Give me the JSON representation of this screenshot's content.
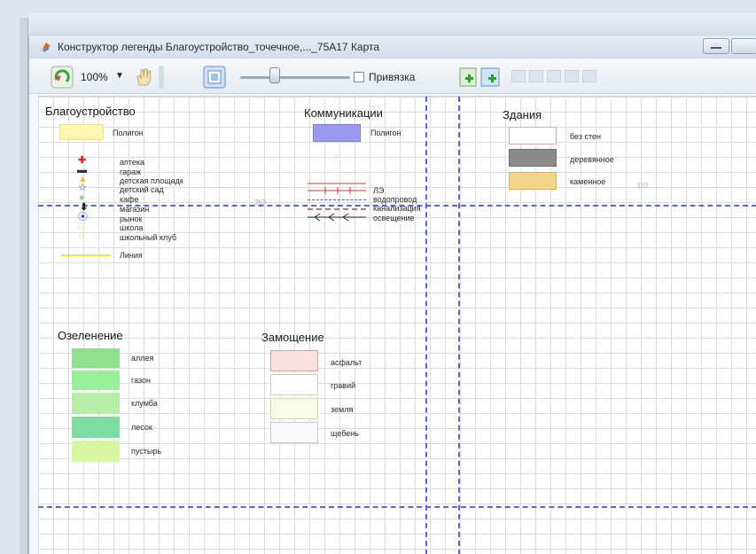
{
  "window": {
    "title": "Конструктор легенды Благоустройство_точечное,..._75А17 Карта"
  },
  "toolbar": {
    "zoom_value": "100%",
    "snap_label": "Привязка",
    "snap_checked": false,
    "zoom_slider_level": 0.27
  },
  "sections": {
    "blagoustroistvo": {
      "title": "Благоустройство",
      "polygon_label": "Полигон",
      "points": [
        {
          "label": "аптека",
          "icon": "cross-icon"
        },
        {
          "label": "гараж",
          "icon": "bar-icon"
        },
        {
          "label": "детская площадк",
          "icon": "triangle-icon"
        },
        {
          "label": "детский сад",
          "icon": "star-icon"
        },
        {
          "label": "кафе",
          "icon": "dot-icon"
        },
        {
          "label": "магазин",
          "icon": "arrow-down-icon"
        },
        {
          "label": "рынок",
          "icon": "target-icon"
        },
        {
          "label": "школа",
          "icon": "square-outline-icon"
        },
        {
          "label": "школьный клуб",
          "icon": "circle-outline-icon"
        }
      ],
      "line_label": "Линия"
    },
    "kommunikatsii": {
      "title": "Коммуникации",
      "polygon_label": "Полигон",
      "lines": [
        {
          "label": "ЛЭ",
          "color": "#e0303a"
        },
        {
          "label": "водопровод",
          "color": "#4b5bd8"
        },
        {
          "label": "канализация",
          "color": "#b07a86"
        },
        {
          "label": "освещение",
          "color": "#2a2a2a"
        }
      ]
    },
    "zdaniya": {
      "title": "Здания",
      "items": [
        {
          "label": "без стен",
          "fill": "#ffffff",
          "stroke": "#e7a6aa"
        },
        {
          "label": "деревянное",
          "fill": "#8a8a8a",
          "stroke": "#6f6f6f"
        },
        {
          "label": "каменное",
          "fill": "#f4d48a",
          "stroke": "#d7b060"
        }
      ]
    },
    "ozelenenie": {
      "title": "Озеленение",
      "items": [
        {
          "label": "аллея",
          "fill": "#8fe08f"
        },
        {
          "label": "газон",
          "fill": "#99f09a"
        },
        {
          "label": "клумба",
          "fill": "#b6f0a8"
        },
        {
          "label": "лесок",
          "fill": "#7fdca0"
        },
        {
          "label": "пустырь",
          "fill": "#d6f79e"
        }
      ]
    },
    "zamoshchenie": {
      "title": "Замощение",
      "items": [
        {
          "label": "асфальт",
          "fill": "#fbe0e0",
          "stroke": "#d4a3a3"
        },
        {
          "label": "гравий",
          "fill": "#ffffff",
          "stroke": "#c8cfc0"
        },
        {
          "label": "земля",
          "fill": "#f9fde8",
          "stroke": "#d0d8b0"
        },
        {
          "label": "щебень",
          "fill": "#fafafa",
          "stroke": "#c5c9cc"
        }
      ]
    }
  },
  "colors": {
    "guide": "#5d63e0",
    "polygon_blago": "#fff7b0",
    "polygon_komm": "#9a9af0",
    "line_blago": "#f2e23a"
  }
}
